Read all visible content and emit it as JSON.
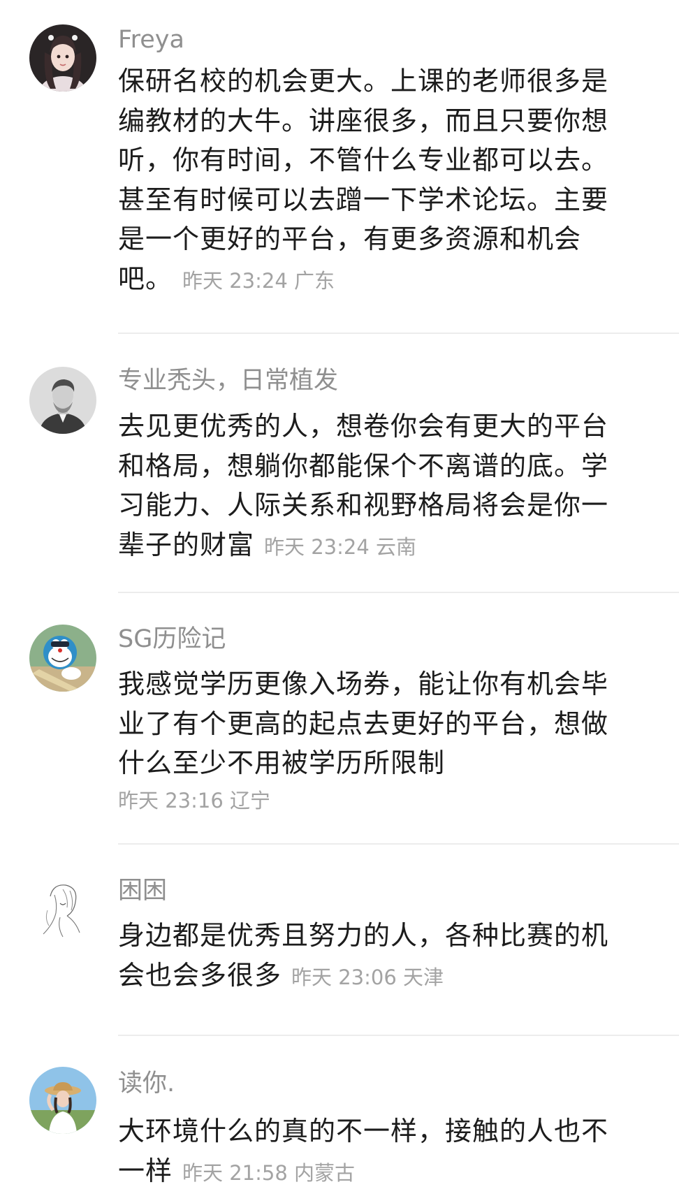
{
  "comments": [
    {
      "username": "Freya",
      "text": "保研名校的机会更大。上课的老师很多是编教材的大牛。讲座很多，而且只要你想听，你有时间，不管什么专业都可以去。甚至有时候可以去蹭一下学术论坛。主要是一个更好的平台，有更多资源和机会吧。",
      "time": "昨天 23:24",
      "location": "广东",
      "avatar": "avatar-girl-icon"
    },
    {
      "username": "专业秃头，日常植发",
      "text": "去见更优秀的人，想卷你会有更大的平台和格局，想躺你都能保个不离谱的底。学习能力、人际关系和视野格局将会是你一辈子的财富",
      "time": "昨天 23:24",
      "location": "云南",
      "avatar": "avatar-portrait-icon"
    },
    {
      "username": "SG历险记",
      "text": "我感觉学历更像入场券，能让你有机会毕业了有个更高的起点去更好的平台，想做什么至少不用被学历所限制",
      "time": "昨天 23:16",
      "location": "辽宁",
      "avatar": "avatar-cartoon-icon"
    },
    {
      "username": "困困",
      "text": "身边都是优秀且努力的人，各种比赛的机会也会多很多",
      "time": "昨天 23:06",
      "location": "天津",
      "avatar": "avatar-sketch-icon"
    },
    {
      "username": "读你.",
      "text": "大环境什么的真的不一样，接触的人也不一样",
      "time": "昨天 21:58",
      "location": "内蒙古",
      "avatar": "avatar-photo-icon"
    }
  ]
}
